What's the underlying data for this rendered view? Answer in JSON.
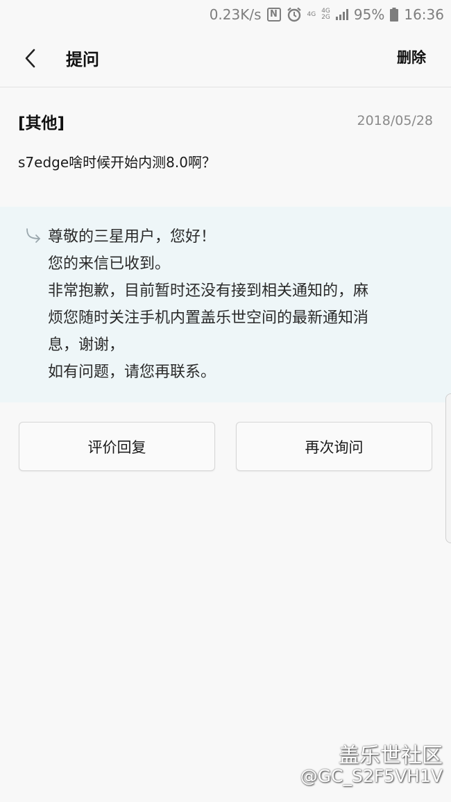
{
  "status_bar": {
    "net_speed": "0.23K/s",
    "nfc_label": "N",
    "net_top": "4G",
    "net_mid": "4G",
    "net_bottom": "2G",
    "battery": "95%",
    "time": "16:36",
    "icons": [
      "nfc-icon",
      "alarm-icon",
      "signal-icon",
      "battery-icon"
    ]
  },
  "app_bar": {
    "title": "提问",
    "delete_label": "删除",
    "back_icon": "back-chevron-icon"
  },
  "question": {
    "category": "[其他]",
    "date": "2018/05/28",
    "text": "s7edge啥时候开始内测8.0啊？"
  },
  "reply": {
    "icon": "reply-arrow-icon",
    "lines": [
      "尊敬的三星用户，您好！",
      "您的来信已收到。",
      "非常抱歉，目前暂时还没有接到相关通知的，麻",
      "烦您随时关注手机内置盖乐世空间的最新通知消",
      "息，谢谢，",
      "如有问题，请您再联系。"
    ]
  },
  "actions": {
    "rate_label": "评价回复",
    "ask_again_label": "再次询问"
  },
  "watermark": {
    "brand": "盖乐世社区",
    "user": "@GC_S2F5VH1V"
  },
  "colors": {
    "background": "#f8f8f8",
    "reply_background": "#eef6f8",
    "muted_text": "#8a8a8a",
    "status_text": "#7d7d7d"
  }
}
